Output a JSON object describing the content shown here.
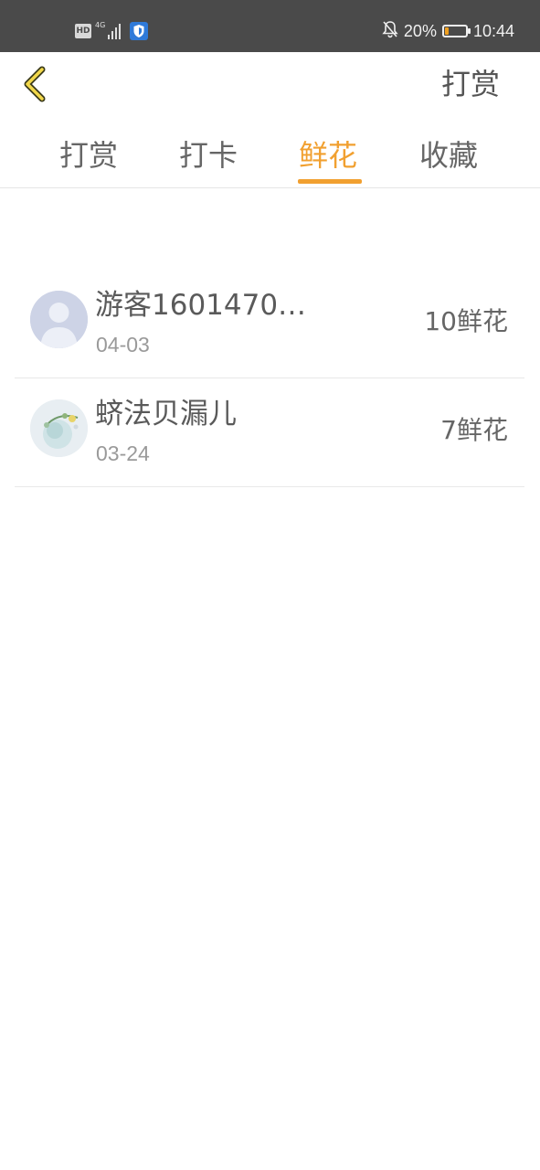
{
  "status_bar": {
    "hd": "HD",
    "network": "4G",
    "battery_percent": "20%",
    "battery_level": 0.2,
    "time": "10:44"
  },
  "header": {
    "back_icon": "chevron-left-icon",
    "action_label": "打赏"
  },
  "tabs": [
    {
      "label": "打赏",
      "active": false
    },
    {
      "label": "打卡",
      "active": false
    },
    {
      "label": "鲜花",
      "active": true
    },
    {
      "label": "收藏",
      "active": false
    }
  ],
  "colors": {
    "accent": "#f1a030",
    "status_bar_bg": "#4a4a4a",
    "shield": "#2f7ad9"
  },
  "list": [
    {
      "name": "游客1601470…",
      "date": "04-03",
      "count": "10鲜花",
      "avatar": "default-avatar"
    },
    {
      "name": "蛴法贝漏儿",
      "date": "03-24",
      "count": "7鲜花",
      "avatar": "photo-avatar"
    }
  ]
}
